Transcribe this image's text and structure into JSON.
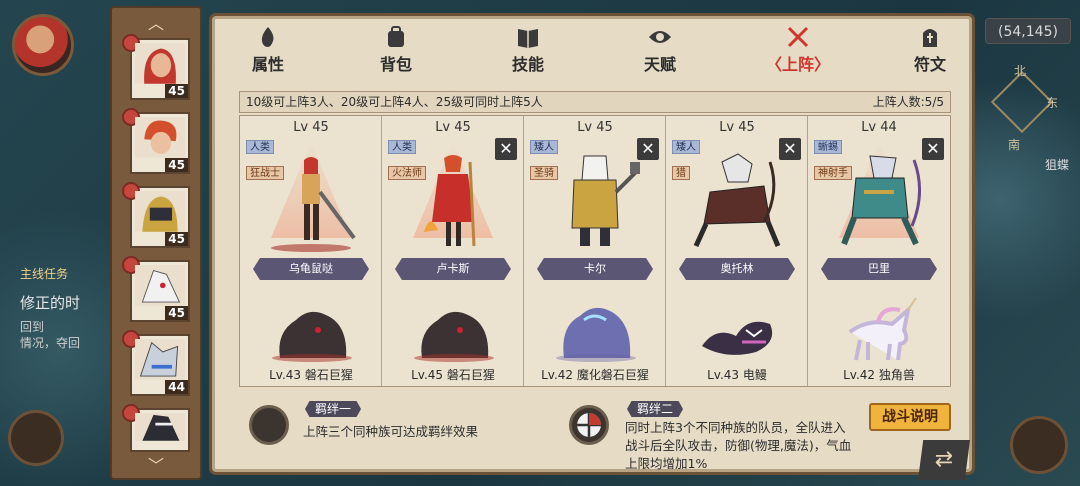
{
  "map": {
    "coordinates": "(54,145)",
    "compass": {
      "north": "北",
      "east": "东",
      "south": "南"
    },
    "side_text": "狙蝶",
    "quest": {
      "type": "主线任务",
      "title": "修正的时",
      "desc_1": "回到",
      "desc_2": "情况，夺回"
    }
  },
  "roster": {
    "up": "︿",
    "down": "﹀",
    "heroes": [
      {
        "level": "45"
      },
      {
        "level": "45"
      },
      {
        "level": "45"
      },
      {
        "level": "45"
      },
      {
        "level": "44"
      },
      {
        "level": ""
      }
    ]
  },
  "tabs": [
    {
      "label": "属性"
    },
    {
      "label": "背包"
    },
    {
      "label": "技能"
    },
    {
      "label": "天赋"
    },
    {
      "label": "上阵",
      "active": true
    },
    {
      "label": "符文"
    }
  ],
  "formation": {
    "info": "10级可上阵3人、20级可上阵4人、25级可同时上阵5人",
    "count_label": "上阵人数:5/5",
    "cards": [
      {
        "level": "Lv 45",
        "race": "人类",
        "class": "狂战士",
        "name": "乌龟鼠哒",
        "pet": "Lv.43 磐石巨猩",
        "removable": false
      },
      {
        "level": "Lv 45",
        "race": "人类",
        "class": "火法师",
        "name": "卢卡斯",
        "pet": "Lv.45 磐石巨猩",
        "removable": true
      },
      {
        "level": "Lv 45",
        "race": "矮人",
        "class": "圣骑",
        "name": "卡尔",
        "pet": "Lv.42 魔化磐石巨猩",
        "removable": true
      },
      {
        "level": "Lv 45",
        "race": "矮人",
        "class": "猎",
        "name": "奥托林",
        "pet": "Lv.43 电鳗",
        "removable": true
      },
      {
        "level": "Lv 44",
        "race": "蜥蜴",
        "class": "神射手",
        "name": "巴里",
        "pet": "Lv.42 独角兽",
        "removable": true
      }
    ],
    "close_glyph": "✕"
  },
  "bonds": [
    {
      "title": "羁绊一",
      "desc": "上阵三个同种族可达成羁绊效果"
    },
    {
      "title": "羁绊二",
      "desc_1": "同时上阵3个不同种族的队员，全队进入",
      "desc_2": "战斗后全队攻击，防御(物理,魔法)，气血",
      "desc_3": "上限均增加1%"
    }
  ],
  "buttons": {
    "battle_info": "战斗说明",
    "return": "⇄"
  },
  "colors": {
    "active_tab": "#d0352d",
    "battle_button": "#f0b33c",
    "panel": "#e6dcc6"
  }
}
